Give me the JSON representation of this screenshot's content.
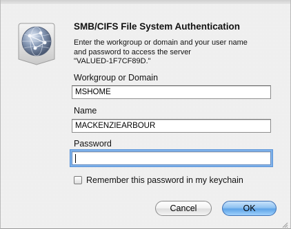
{
  "dialog": {
    "title": "SMB/CIFS File System Authentication",
    "description_lines": [
      "Enter the workgroup or domain and your user name",
      "and password to access the server",
      "\"VALUED-1F7CF89D.\""
    ],
    "icon": "network-globe-icon"
  },
  "workgroup": {
    "label": "Workgroup or Domain",
    "value": "MSHOME"
  },
  "name": {
    "label": "Name",
    "value": "MACKENZIEARBOUR"
  },
  "password": {
    "label": "Password",
    "value": ""
  },
  "remember": {
    "label": "Remember this password in my keychain",
    "checked": false
  },
  "buttons": {
    "cancel": "Cancel",
    "ok": "OK"
  },
  "colors": {
    "ok_button": "#6aaeed",
    "focus_ring": "#7fb2ea"
  }
}
